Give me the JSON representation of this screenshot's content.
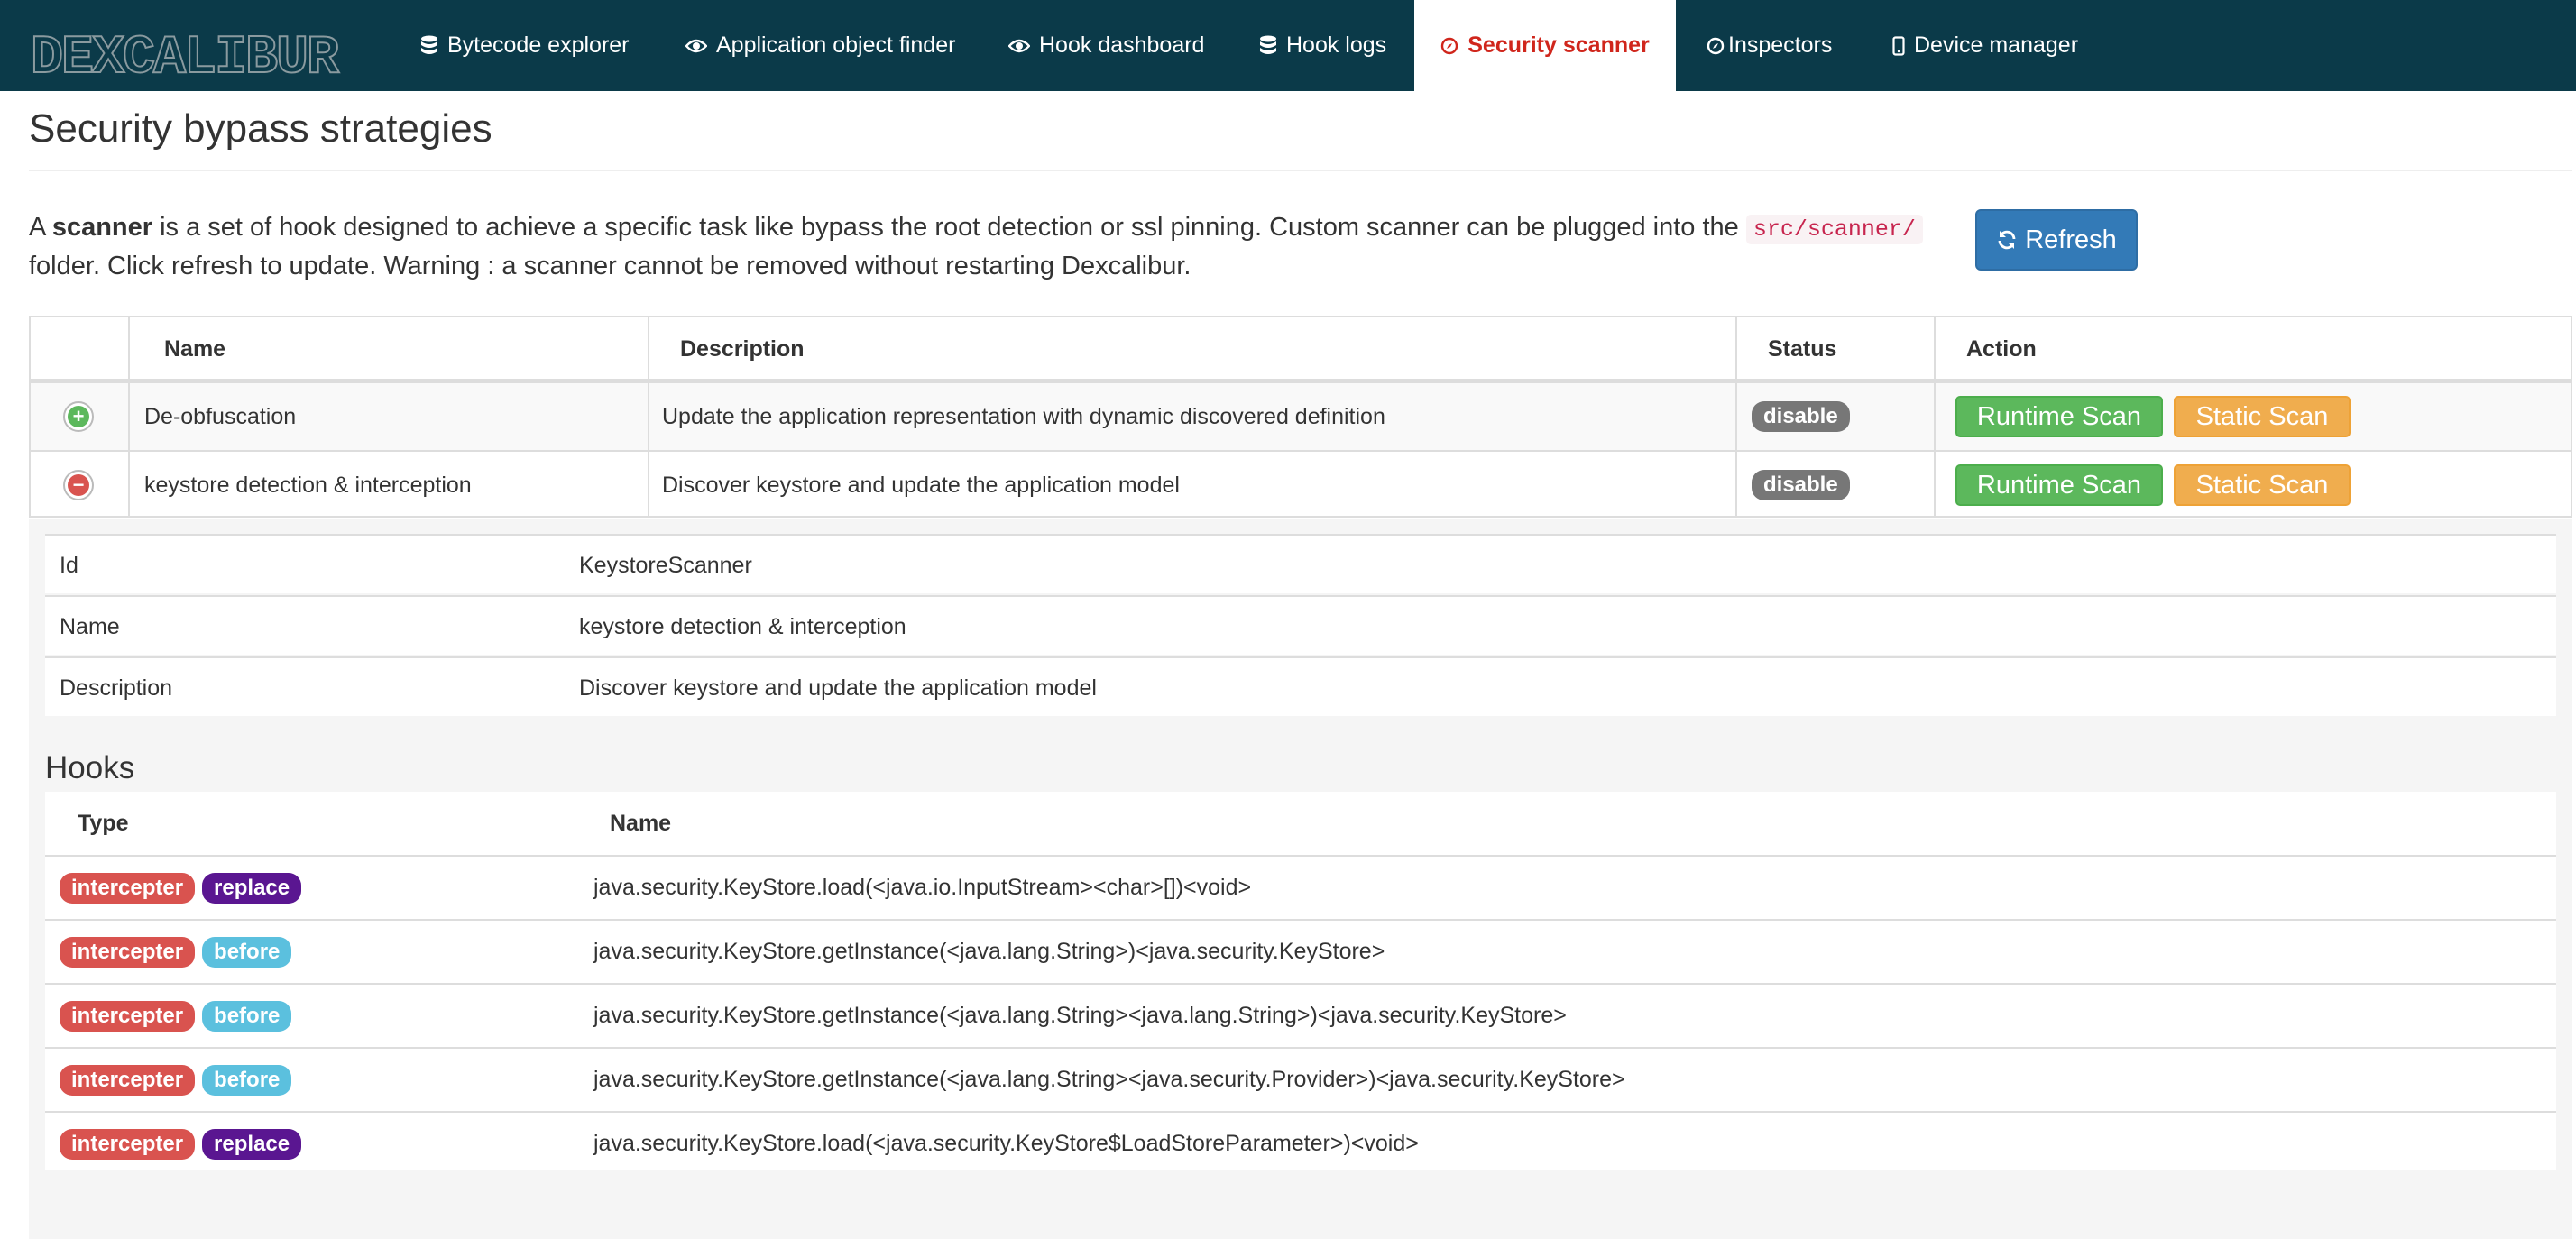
{
  "brand": {
    "name": "DEXCALIBUR",
    "color": "#7a8a8f"
  },
  "nav": {
    "items": [
      {
        "label": "Bytecode explorer",
        "icon": "database-icon"
      },
      {
        "label": "Application object finder",
        "icon": "eye-icon"
      },
      {
        "label": "Hook dashboard",
        "icon": "eye-icon"
      },
      {
        "label": "Hook logs",
        "icon": "database-icon"
      },
      {
        "label": "Security scanner",
        "icon": "compass-icon",
        "active": true
      },
      {
        "label": "Inspectors",
        "icon": "compass-icon"
      },
      {
        "label": "Device manager",
        "icon": "phone-icon"
      }
    ]
  },
  "page": {
    "title": "Security bypass strategies",
    "intro": {
      "prefix": "A ",
      "bold": "scanner",
      "middle": " is a set of hook designed to achieve a specific task like bypass the root detection or ssl pinning. Custom scanner can be plugged into the ",
      "code": "src/scanner/",
      "suffix": " folder. Click refresh to update. Warning : a scanner cannot be removed without restarting Dexcalibur."
    },
    "refresh_label": "Refresh"
  },
  "scanners": {
    "headers": {
      "name": "Name",
      "description": "Description",
      "status": "Status",
      "action": "Action"
    },
    "rows": [
      {
        "state": "add",
        "state_symbol": "+",
        "name": "De-obfuscation",
        "description": "Update the application representation with dynamic discovered definition",
        "status": "disable",
        "runtime_label": "Runtime Scan",
        "static_label": "Static Scan"
      },
      {
        "state": "remove",
        "state_symbol": "−",
        "name": "keystore detection & interception",
        "description": "Discover keystore and update the application model",
        "status": "disable",
        "runtime_label": "Runtime Scan",
        "static_label": "Static Scan"
      }
    ]
  },
  "detail": {
    "fields": [
      {
        "key": "Id",
        "value": "KeystoreScanner"
      },
      {
        "key": "Name",
        "value": "keystore detection & interception"
      },
      {
        "key": "Description",
        "value": "Discover keystore and update the application model"
      }
    ],
    "hooks_title": "Hooks",
    "hooks_headers": {
      "type": "Type",
      "name": "Name"
    },
    "hooks": [
      {
        "type1": "intercepter",
        "type2": "replace",
        "name": "java.security.KeyStore.load(<java.io.InputStream><char>[])<void>"
      },
      {
        "type1": "intercepter",
        "type2": "before",
        "name": "java.security.KeyStore.getInstance(<java.lang.String>)<java.security.KeyStore>"
      },
      {
        "type1": "intercepter",
        "type2": "before",
        "name": "java.security.KeyStore.getInstance(<java.lang.String><java.lang.String>)<java.security.KeyStore>"
      },
      {
        "type1": "intercepter",
        "type2": "before",
        "name": "java.security.KeyStore.getInstance(<java.lang.String><java.security.Provider>)<java.security.KeyStore>"
      },
      {
        "type1": "intercepter",
        "type2": "replace",
        "name": "java.security.KeyStore.load(<java.security.KeyStore$LoadStoreParameter>)<void>"
      }
    ]
  },
  "colors": {
    "navbar": "#0b3a49",
    "active_tab_text": "#d0261c",
    "refresh": "#337ab7",
    "runtime": "#5cb85c",
    "static": "#f0ad4e",
    "intercepter": "#d9534f",
    "replace": "#5a1691",
    "before": "#5bc0de"
  }
}
